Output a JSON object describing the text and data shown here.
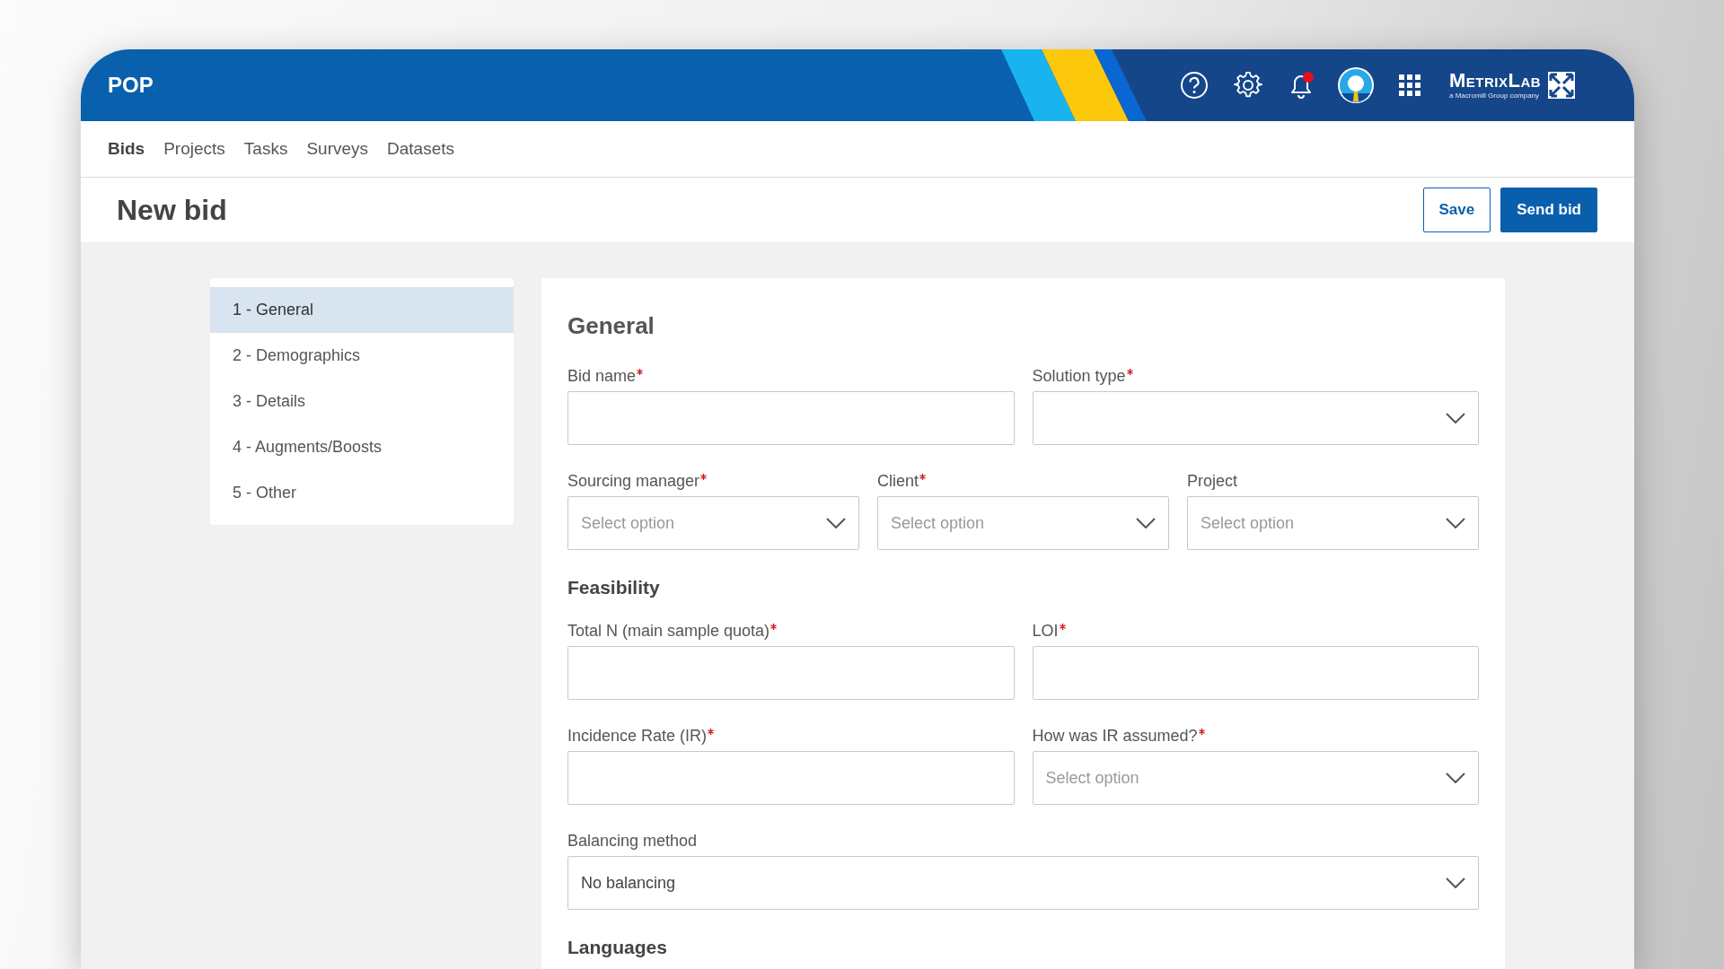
{
  "header": {
    "app_name": "POP",
    "notifications_unread": true,
    "brand": {
      "name": "MetrixLab",
      "tagline": "a Macromill Group company"
    }
  },
  "nav": [
    {
      "label": "Bids",
      "selected": true
    },
    {
      "label": "Projects",
      "selected": false
    },
    {
      "label": "Tasks",
      "selected": false
    },
    {
      "label": "Surveys",
      "selected": false
    },
    {
      "label": "Datasets",
      "selected": false
    }
  ],
  "page": {
    "title": "New bid",
    "buttons": [
      {
        "label": "Save",
        "kind": "secondary"
      },
      {
        "label": "Send bid",
        "kind": "primary"
      }
    ]
  },
  "steps": [
    {
      "label": "1 - General",
      "selected": true
    },
    {
      "label": "2 - Demographics",
      "selected": false
    },
    {
      "label": "3 - Details",
      "selected": false
    },
    {
      "label": "4 - Augments/Boosts",
      "selected": false
    },
    {
      "label": "5 - Other",
      "selected": false
    }
  ],
  "form": {
    "title": "General",
    "sections": [
      {
        "rows": [
          [
            {
              "label": "Bid name",
              "required": true,
              "kind": "text"
            },
            {
              "label": "Solution type",
              "required": true,
              "kind": "select"
            }
          ],
          [
            {
              "label": "Sourcing manager",
              "required": true,
              "kind": "select",
              "placeholder": "Select option"
            },
            {
              "label": "Client",
              "required": true,
              "kind": "select",
              "placeholder": "Select option"
            },
            {
              "label": "Project",
              "required": false,
              "kind": "select",
              "placeholder": "Select option"
            }
          ]
        ]
      },
      {
        "title": "Feasibility",
        "rows": [
          [
            {
              "label": "Total N (main sample quota)",
              "required": true,
              "kind": "text"
            },
            {
              "label": "LOI",
              "required": true,
              "kind": "text"
            }
          ],
          [
            {
              "label": "Incidence Rate (IR)",
              "required": true,
              "kind": "text"
            },
            {
              "label": "How was IR assumed?",
              "required": true,
              "kind": "select",
              "placeholder": "Select option"
            }
          ],
          [
            {
              "label": "Balancing method",
              "required": false,
              "kind": "select",
              "value": "No balancing"
            }
          ]
        ]
      },
      {
        "title": "Languages"
      }
    ]
  }
}
